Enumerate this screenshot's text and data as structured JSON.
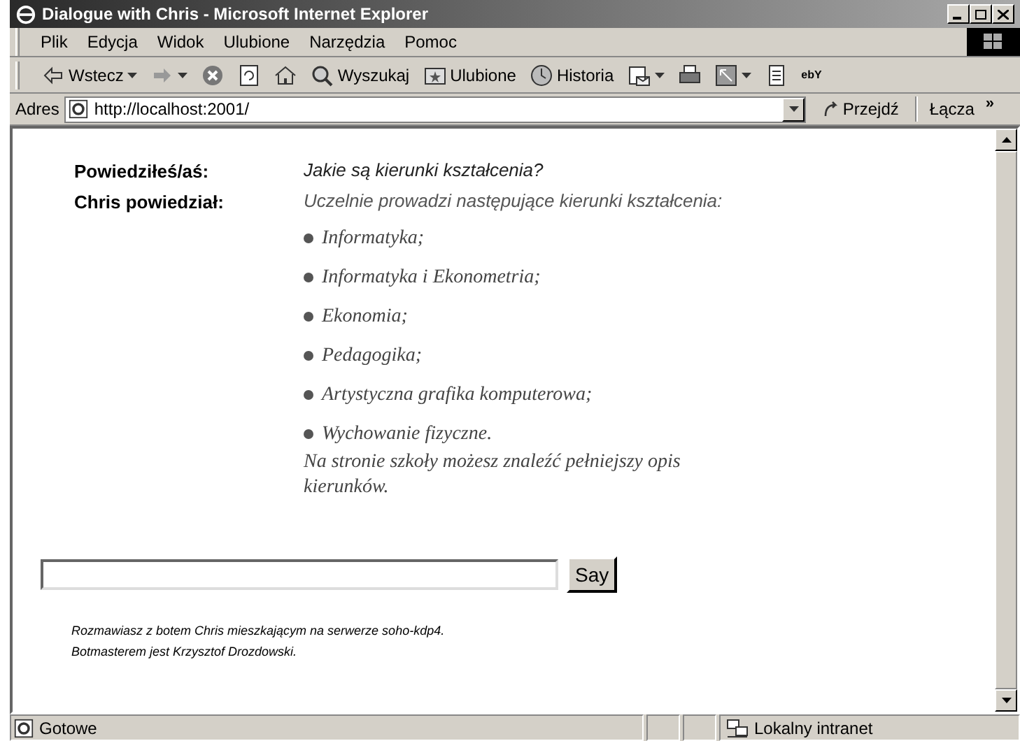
{
  "window": {
    "title": "Dialogue with Chris - Microsoft Internet Explorer"
  },
  "menu": [
    "Plik",
    "Edycja",
    "Widok",
    "Ulubione",
    "Narzędzia",
    "Pomoc"
  ],
  "toolbar": [
    {
      "kind": "back",
      "label": "Wstecz"
    },
    {
      "kind": "forward"
    },
    {
      "kind": "stop"
    },
    {
      "kind": "refresh"
    },
    {
      "kind": "home"
    },
    {
      "kind": "search",
      "label": "Wyszukaj"
    },
    {
      "kind": "favorites",
      "label": "Ulubione"
    },
    {
      "kind": "history",
      "label": "Historia"
    },
    {
      "kind": "mail"
    },
    {
      "kind": "print"
    },
    {
      "kind": "edit"
    },
    {
      "kind": "discuss"
    },
    {
      "kind": "ebay",
      "label": "ebY"
    }
  ],
  "address": {
    "label": "Adres",
    "value": "http://localhost:2001/",
    "go": "Przejdź",
    "links": "Łącza",
    "more": "»"
  },
  "dialogue": [
    {
      "speaker": "Powiedziłeś/aś:",
      "kind": "user",
      "text": "Jakie są kierunki kształcenia?"
    },
    {
      "speaker": "Chris powiedział:",
      "kind": "bot",
      "text": "Uczelnie prowadzi następujące kierunki kształcenia:",
      "items": [
        "Informatyka;",
        "Informatyka i Ekonometria;",
        "Ekonomia;",
        "Pedagogika;",
        "Artystyczna grafika komputerowa;",
        "Wychowanie fizyczne."
      ],
      "closing": "Na stronie szkoły możesz znaleźć pełniejszy opis kierunków."
    }
  ],
  "say_button": "Say",
  "footer": [
    "Rozmawiasz z botem Chris mieszkającym na serwerze soho-kdp4.",
    "Botmasterem jest Krzysztof Drozdowski."
  ],
  "status_bar": {
    "text": "Gotowe",
    "zone": "Lokalny intranet"
  }
}
